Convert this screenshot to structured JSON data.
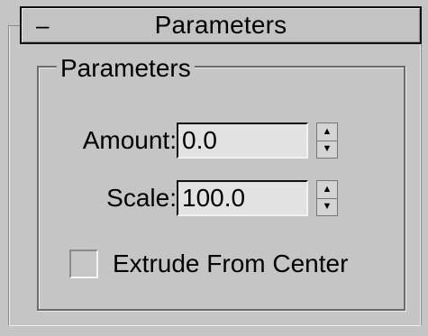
{
  "rollout": {
    "collapse_symbol": "–",
    "title": "Parameters"
  },
  "group": {
    "legend": "Parameters"
  },
  "fields": {
    "amount": {
      "label": "Amount:",
      "value": "0.0",
      "spin_up": "▲",
      "spin_down": "▼"
    },
    "scale": {
      "label": "Scale:",
      "value": "100.0",
      "spin_up": "▲",
      "spin_down": "▼"
    }
  },
  "extrude": {
    "label": "Extrude From Center",
    "checked": false
  }
}
